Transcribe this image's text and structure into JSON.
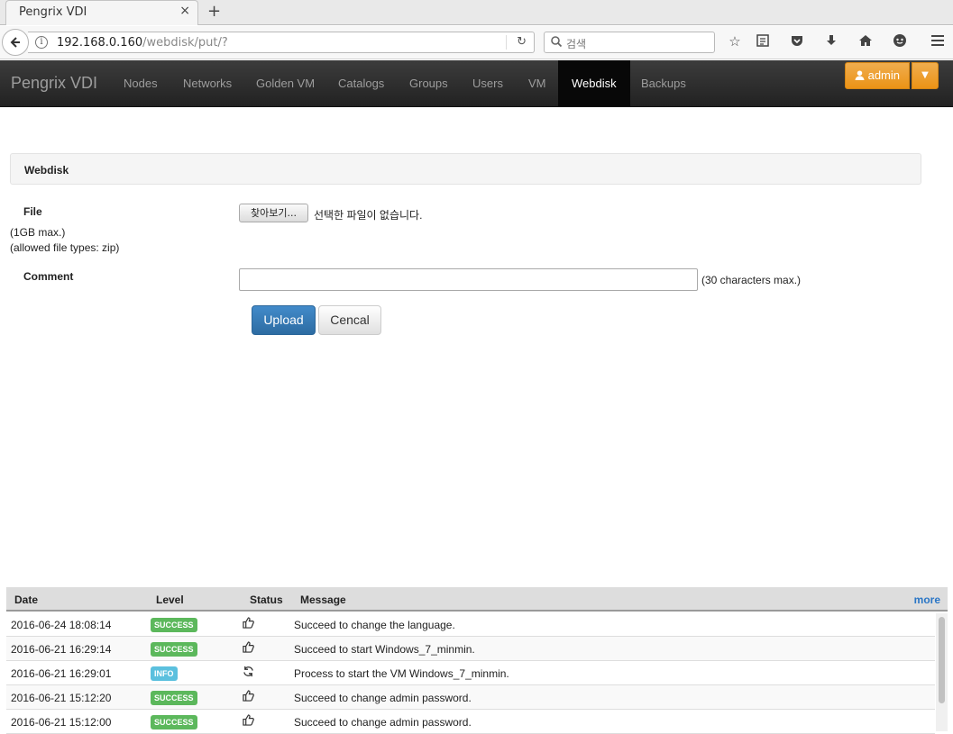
{
  "browser": {
    "tab_title": "Pengrix VDI",
    "tab_close": "×",
    "new_tab": "+",
    "url_host": "192.168.0.160",
    "url_path": "/webdisk/put/?",
    "search_placeholder": "검색",
    "toolbar_icons": [
      "star-icon",
      "reading-list-icon",
      "pocket-icon",
      "download-icon",
      "home-icon",
      "chat-icon",
      "menu-icon"
    ]
  },
  "app": {
    "brand": "Pengrix VDI",
    "nav": [
      "Nodes",
      "Networks",
      "Golden VM",
      "Catalogs",
      "Groups",
      "Users",
      "VM",
      "Webdisk",
      "Backups"
    ],
    "active_nav": "Webdisk",
    "user_button": "admin"
  },
  "form": {
    "panel_title": "Webdisk",
    "file_label": "File",
    "file_hint_size": "(1GB max.)",
    "file_hint_types": "(allowed file types: zip)",
    "file_button": "찾아보기...",
    "file_status": "선택한 파일이 없습니다.",
    "comment_label": "Comment",
    "comment_value": "",
    "comment_hint": "(30 characters max.)",
    "upload_label": "Upload",
    "cancel_label": "Cencal"
  },
  "log": {
    "headers": {
      "date": "Date",
      "level": "Level",
      "status": "Status",
      "message": "Message",
      "more": "more"
    },
    "rows": [
      {
        "date": "2016-06-24 18:08:14",
        "level": "SUCCESS",
        "status_icon": "thumbs-up-icon",
        "message": "Succeed to change the language."
      },
      {
        "date": "2016-06-21 16:29:14",
        "level": "SUCCESS",
        "status_icon": "thumbs-up-icon",
        "message": "Succeed to start Windows_7_minmin."
      },
      {
        "date": "2016-06-21 16:29:01",
        "level": "INFO",
        "status_icon": "refresh-icon",
        "message": "Process to start the VM Windows_7_minmin."
      },
      {
        "date": "2016-06-21 15:12:20",
        "level": "SUCCESS",
        "status_icon": "thumbs-up-icon",
        "message": "Succeed to change admin password."
      },
      {
        "date": "2016-06-21 15:12:00",
        "level": "SUCCESS",
        "status_icon": "thumbs-up-icon",
        "message": "Succeed to change admin password."
      }
    ]
  },
  "colors": {
    "success": "#5cb85c",
    "info": "#5bc0de",
    "primary": "#2d6ca2",
    "warning": "#f0ad4e",
    "navbar": "#222222"
  }
}
